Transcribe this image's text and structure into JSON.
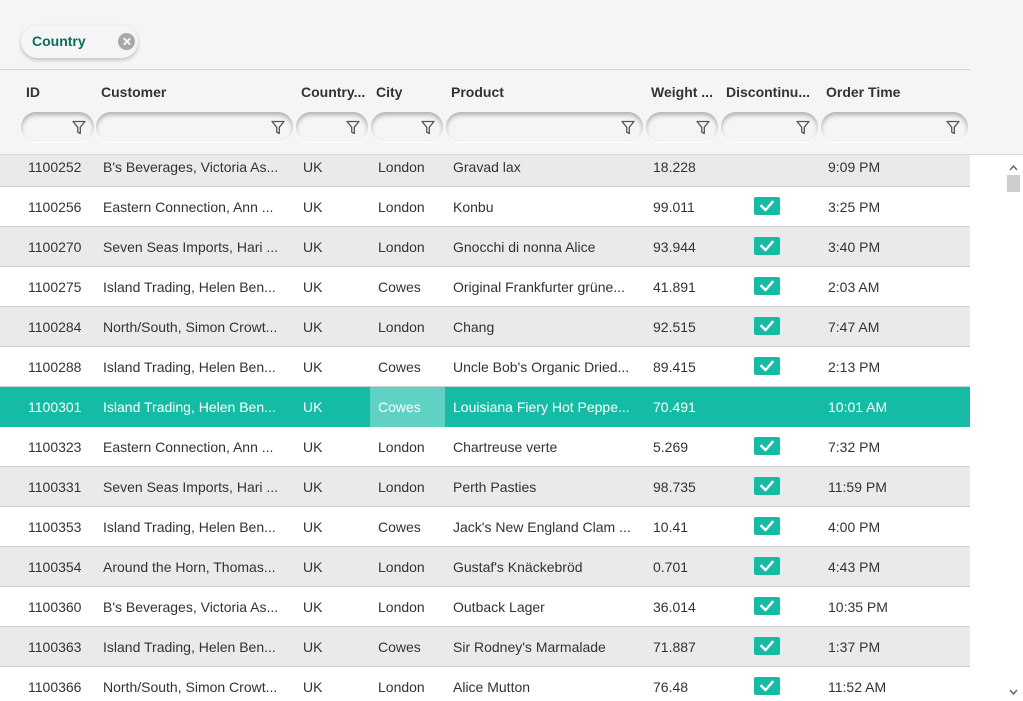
{
  "group_panel": {
    "chip_label": "Country"
  },
  "columns": [
    {
      "key": "id",
      "label": "ID"
    },
    {
      "key": "customer",
      "label": "Customer"
    },
    {
      "key": "country",
      "label": "Country..."
    },
    {
      "key": "city",
      "label": "City"
    },
    {
      "key": "product",
      "label": "Product"
    },
    {
      "key": "weight",
      "label": "Weight ..."
    },
    {
      "key": "discontinued",
      "label": "Discontinu..."
    },
    {
      "key": "order_time",
      "label": "Order Time"
    }
  ],
  "rows": [
    {
      "id": "1100252",
      "customer": "B's Beverages, Victoria As...",
      "country": "UK",
      "city": "London",
      "product": "Gravad lax",
      "weight": "18.228",
      "discontinued": false,
      "order_time": "9:09 PM"
    },
    {
      "id": "1100256",
      "customer": "Eastern Connection, Ann ...",
      "country": "UK",
      "city": "London",
      "product": "Konbu",
      "weight": "99.011",
      "discontinued": true,
      "order_time": "3:25 PM"
    },
    {
      "id": "1100270",
      "customer": "Seven Seas Imports, Hari ...",
      "country": "UK",
      "city": "London",
      "product": "Gnocchi di nonna Alice",
      "weight": "93.944",
      "discontinued": true,
      "order_time": "3:40 PM"
    },
    {
      "id": "1100275",
      "customer": "Island Trading, Helen Ben...",
      "country": "UK",
      "city": "Cowes",
      "product": "Original Frankfurter grüne...",
      "weight": "41.891",
      "discontinued": true,
      "order_time": "2:03 AM"
    },
    {
      "id": "1100284",
      "customer": "North/South, Simon Crowt...",
      "country": "UK",
      "city": "London",
      "product": "Chang",
      "weight": "92.515",
      "discontinued": true,
      "order_time": "7:47 AM"
    },
    {
      "id": "1100288",
      "customer": "Island Trading, Helen Ben...",
      "country": "UK",
      "city": "Cowes",
      "product": "Uncle Bob's Organic Dried...",
      "weight": "89.415",
      "discontinued": true,
      "order_time": "2:13 PM"
    },
    {
      "id": "1100301",
      "customer": "Island Trading, Helen Ben...",
      "country": "UK",
      "city": "Cowes",
      "product": "Louisiana Fiery Hot Peppe...",
      "weight": "70.491",
      "discontinued": false,
      "order_time": "10:01 AM",
      "selected": true
    },
    {
      "id": "1100323",
      "customer": "Eastern Connection, Ann ...",
      "country": "UK",
      "city": "London",
      "product": "Chartreuse verte",
      "weight": "5.269",
      "discontinued": true,
      "order_time": "7:32 PM"
    },
    {
      "id": "1100331",
      "customer": "Seven Seas Imports, Hari ...",
      "country": "UK",
      "city": "London",
      "product": "Perth Pasties",
      "weight": "98.735",
      "discontinued": true,
      "order_time": "11:59 PM"
    },
    {
      "id": "1100353",
      "customer": "Island Trading, Helen Ben...",
      "country": "UK",
      "city": "Cowes",
      "product": "Jack's New England Clam ...",
      "weight": "10.41",
      "discontinued": true,
      "order_time": "4:00 PM"
    },
    {
      "id": "1100354",
      "customer": "Around the Horn, Thomas...",
      "country": "UK",
      "city": "London",
      "product": "Gustaf's Knäckebröd",
      "weight": "0.701",
      "discontinued": true,
      "order_time": "4:43 PM"
    },
    {
      "id": "1100360",
      "customer": "B's Beverages, Victoria As...",
      "country": "UK",
      "city": "London",
      "product": "Outback Lager",
      "weight": "36.014",
      "discontinued": true,
      "order_time": "10:35 PM"
    },
    {
      "id": "1100363",
      "customer": "Island Trading, Helen Ben...",
      "country": "UK",
      "city": "Cowes",
      "product": "Sir Rodney's Marmalade",
      "weight": "71.887",
      "discontinued": true,
      "order_time": "1:37 PM"
    },
    {
      "id": "1100366",
      "customer": "North/South, Simon Crowt...",
      "country": "UK",
      "city": "London",
      "product": "Alice Mutton",
      "weight": "76.48",
      "discontinued": true,
      "order_time": "11:52 AM"
    }
  ],
  "colors": {
    "accent": "#16bba6",
    "focused_cell": "#5fd2c4",
    "chip_text": "#0b6b5c"
  },
  "icons": {
    "chip_close": "close-circle-icon",
    "filter": "funnel-icon",
    "checkbox": "checkmark-icon"
  }
}
